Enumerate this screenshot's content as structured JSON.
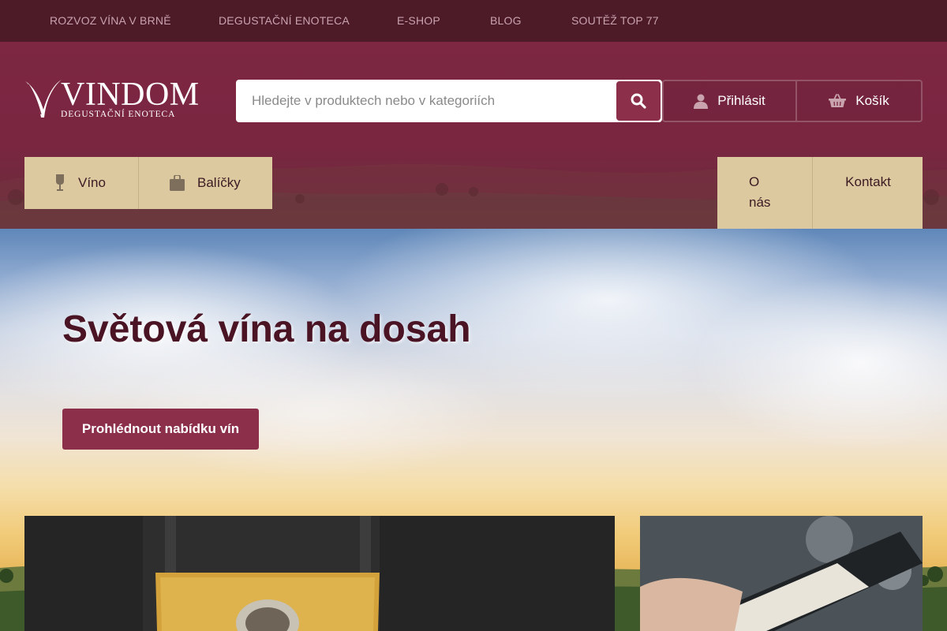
{
  "topbar": {
    "links": [
      "ROZVOZ VÍNA V BRNĚ",
      "DEGUSTAČNÍ ENOTECA",
      "E-SHOP",
      "BLOG",
      "SOUTĚŽ TOP 77"
    ]
  },
  "logo": {
    "name": "VINDOM",
    "tagline": "DEGUSTAČNÍ ENOTECA"
  },
  "search": {
    "placeholder": "Hledejte v produktech nebo v kategoriích",
    "value": "",
    "icon": "search-icon"
  },
  "header_actions": {
    "login": {
      "label": "Přihlásit",
      "icon": "user-icon"
    },
    "cart": {
      "label": "Košík",
      "icon": "basket-icon"
    }
  },
  "nav": {
    "left": [
      {
        "label": "Víno",
        "icon": "wine-bottle-icon"
      },
      {
        "label": "Balíčky",
        "icon": "bag-icon"
      }
    ],
    "right": {
      "about_line1": "O",
      "about_line2": "nás",
      "contact": "Kontakt"
    }
  },
  "hero": {
    "title": "Světová vína na dosah",
    "cta": "Prohlédnout nabídku vín"
  },
  "colors": {
    "topbar_bg": "#4d1a28",
    "header_bg": "#7a2641",
    "accent": "#8b2f4a",
    "nav_bg": "#dcc9a0",
    "title_color": "#4a1424"
  }
}
